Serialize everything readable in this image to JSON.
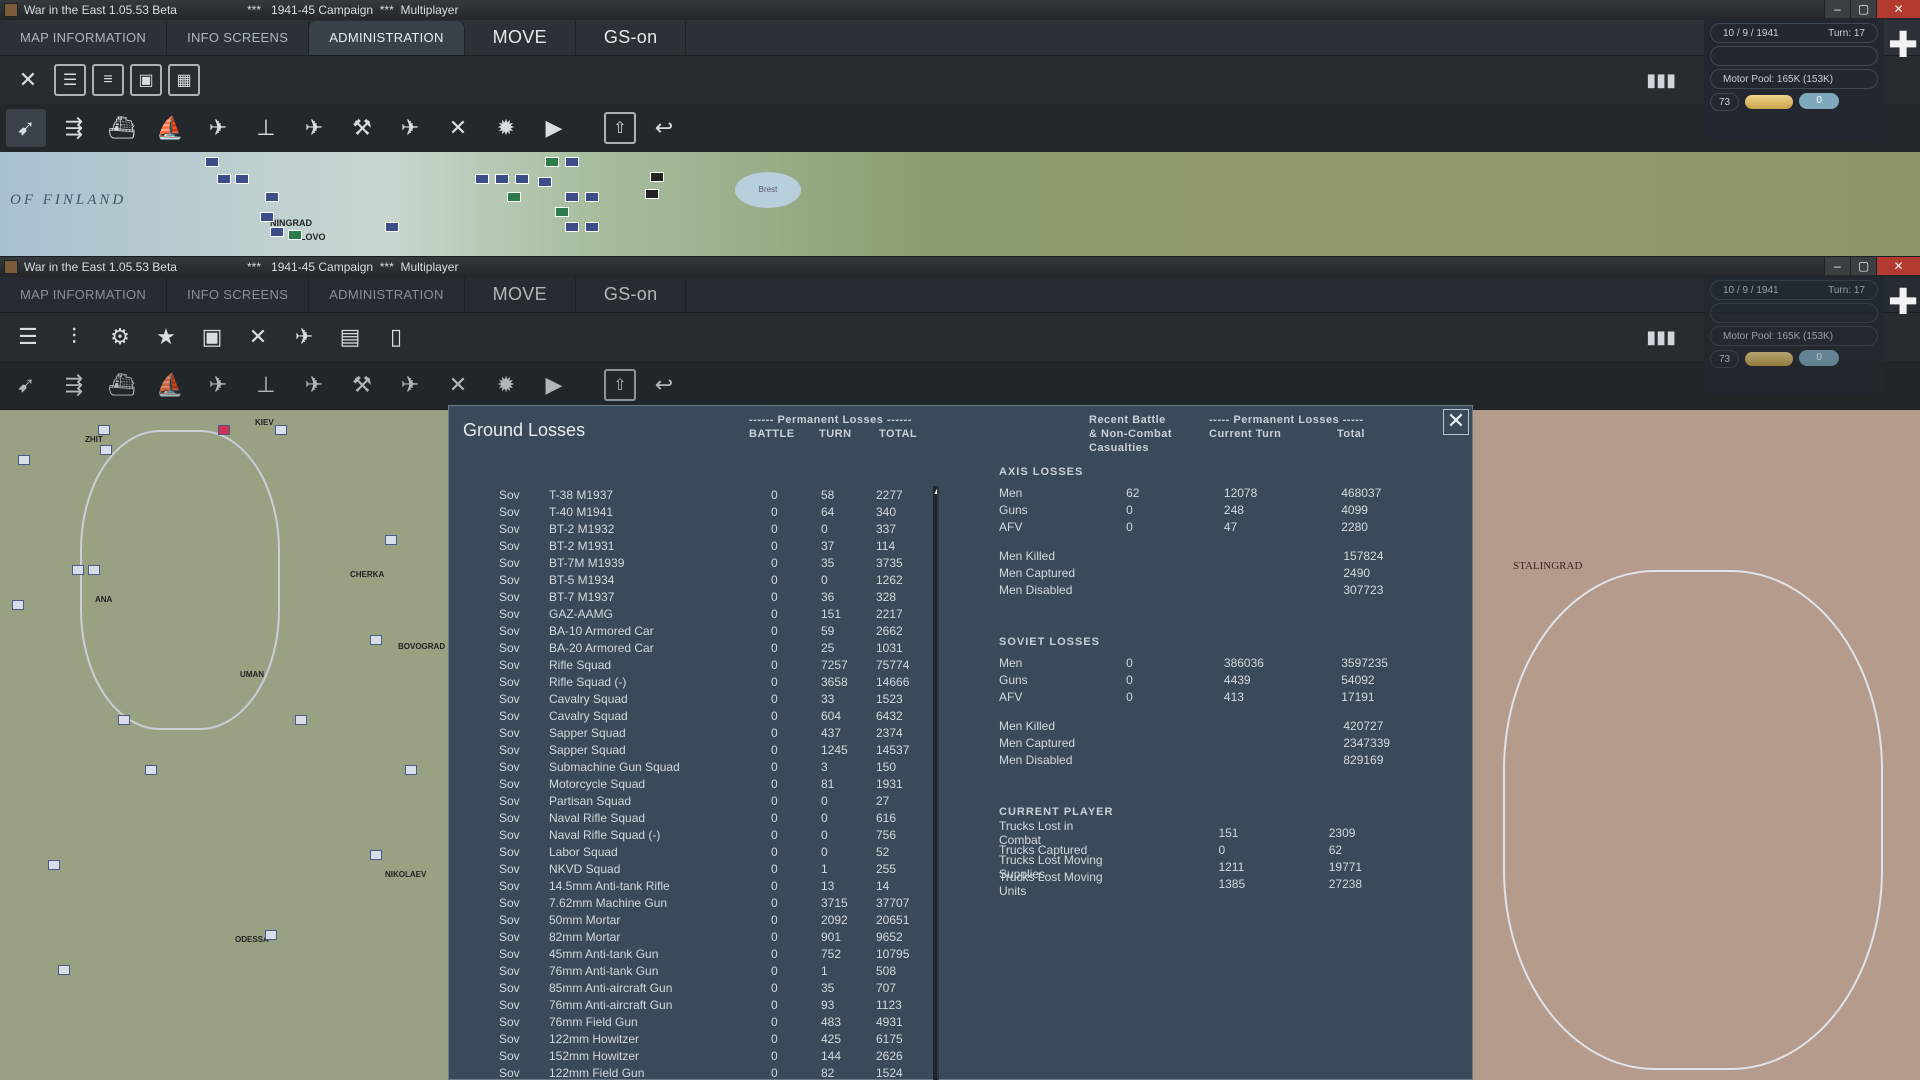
{
  "window": {
    "app_title": "War in the East 1.05.53 Beta",
    "campaign": "1941-45 Campaign",
    "mode": "Multiplayer",
    "stars": "***"
  },
  "menu": {
    "tabs": [
      "MAP INFORMATION",
      "INFO SCREENS",
      "ADMINISTRATION"
    ],
    "move": "MOVE",
    "gs": "GS-on"
  },
  "status": {
    "date": "10 / 9 / 1941",
    "turn": "Turn: 17",
    "motor_pool": "Motor Pool: 165K (153K)",
    "value": "73",
    "toggle": "0"
  },
  "toolbar_keys": [
    "F1",
    "F2",
    "F3",
    "F4",
    "F5",
    "F6",
    "F7",
    "F8",
    "F9",
    "F10",
    "F11",
    "F12"
  ],
  "map_top": {
    "sea_label": "OF FINLAND",
    "city1": "NINGRAD",
    "city2": "LOVO",
    "lake": "Brest"
  },
  "map_left": {
    "cities": [
      "KIEV",
      "ZHIT",
      "CHERKA",
      "UMAN",
      "ANA",
      "BOVOGRAD",
      "NIKOLAEV",
      "ODESSA"
    ]
  },
  "map_right": {
    "city": "STALINGRAD"
  },
  "dialog": {
    "title": "Ground Losses",
    "perm_header": "------ Permanent Losses ------",
    "col_battle": "BATTLE",
    "col_turn": "TURN",
    "col_total": "TOTAL",
    "recent_header": [
      "Recent Battle",
      "& Non-Combat",
      "Casualties"
    ],
    "perm_header2": "----- Permanent Losses -----",
    "col_current": "Current Turn",
    "col_total2": "Total",
    "close": "✕",
    "rows": [
      [
        "Sov",
        "T-38 M1937",
        "0",
        "58",
        "2277"
      ],
      [
        "Sov",
        "T-40 M1941",
        "0",
        "64",
        "340"
      ],
      [
        "Sov",
        "BT-2 M1932",
        "0",
        "0",
        "337"
      ],
      [
        "Sov",
        "BT-2 M1931",
        "0",
        "37",
        "114"
      ],
      [
        "Sov",
        "BT-7M M1939",
        "0",
        "35",
        "3735"
      ],
      [
        "Sov",
        "BT-5 M1934",
        "0",
        "0",
        "1262"
      ],
      [
        "Sov",
        "BT-7 M1937",
        "0",
        "36",
        "328"
      ],
      [
        "Sov",
        "GAZ-AAMG",
        "0",
        "151",
        "2217"
      ],
      [
        "Sov",
        "BA-10 Armored Car",
        "0",
        "59",
        "2662"
      ],
      [
        "Sov",
        "BA-20 Armored Car",
        "0",
        "25",
        "1031"
      ],
      [
        "Sov",
        "Rifle Squad",
        "0",
        "7257",
        "75774"
      ],
      [
        "Sov",
        "Rifle Squad (-)",
        "0",
        "3658",
        "14666"
      ],
      [
        "Sov",
        "Cavalry Squad",
        "0",
        "33",
        "1523"
      ],
      [
        "Sov",
        "Cavalry Squad",
        "0",
        "604",
        "6432"
      ],
      [
        "Sov",
        "Sapper Squad",
        "0",
        "437",
        "2374"
      ],
      [
        "Sov",
        "Sapper Squad",
        "0",
        "1245",
        "14537"
      ],
      [
        "Sov",
        "Submachine Gun Squad",
        "0",
        "3",
        "150"
      ],
      [
        "Sov",
        "Motorcycle Squad",
        "0",
        "81",
        "1931"
      ],
      [
        "Sov",
        "Partisan Squad",
        "0",
        "0",
        "27"
      ],
      [
        "Sov",
        "Naval Rifle Squad",
        "0",
        "0",
        "616"
      ],
      [
        "Sov",
        "Naval Rifle Squad (-)",
        "0",
        "0",
        "756"
      ],
      [
        "Sov",
        "Labor Squad",
        "0",
        "0",
        "52"
      ],
      [
        "Sov",
        "NKVD Squad",
        "0",
        "1",
        "255"
      ],
      [
        "Sov",
        "14.5mm Anti-tank Rifle",
        "0",
        "13",
        "14"
      ],
      [
        "Sov",
        "7.62mm Machine Gun",
        "0",
        "3715",
        "37707"
      ],
      [
        "Sov",
        "50mm Mortar",
        "0",
        "2092",
        "20651"
      ],
      [
        "Sov",
        "82mm Mortar",
        "0",
        "901",
        "9652"
      ],
      [
        "Sov",
        "45mm Anti-tank Gun",
        "0",
        "752",
        "10795"
      ],
      [
        "Sov",
        "76mm Anti-tank Gun",
        "0",
        "1",
        "508"
      ],
      [
        "Sov",
        "85mm Anti-aircraft Gun",
        "0",
        "35",
        "707"
      ],
      [
        "Sov",
        "76mm Anti-aircraft Gun",
        "0",
        "93",
        "1123"
      ],
      [
        "Sov",
        "76mm Field Gun",
        "0",
        "483",
        "4931"
      ],
      [
        "Sov",
        "122mm Howitzer",
        "0",
        "425",
        "6175"
      ],
      [
        "Sov",
        "152mm Howitzer",
        "0",
        "144",
        "2626"
      ],
      [
        "Sov",
        "122mm Field Gun",
        "0",
        "82",
        "1524"
      ]
    ],
    "axis": {
      "title": "AXIS LOSSES",
      "rows": [
        [
          "Men",
          "62",
          "12078",
          "468037"
        ],
        [
          "Guns",
          "0",
          "248",
          "4099"
        ],
        [
          "AFV",
          "0",
          "47",
          "2280"
        ]
      ],
      "extra": [
        [
          "Men Killed",
          "157824"
        ],
        [
          "Men Captured",
          "2490"
        ],
        [
          "Men Disabled",
          "307723"
        ]
      ]
    },
    "soviet": {
      "title": "SOVIET LOSSES",
      "rows": [
        [
          "Men",
          "0",
          "386036",
          "3597235"
        ],
        [
          "Guns",
          "0",
          "4439",
          "54092"
        ],
        [
          "AFV",
          "0",
          "413",
          "17191"
        ]
      ],
      "extra": [
        [
          "Men Killed",
          "420727"
        ],
        [
          "Men Captured",
          "2347339"
        ],
        [
          "Men Disabled",
          "829169"
        ]
      ]
    },
    "player": {
      "title": "CURRENT PLAYER",
      "rows": [
        [
          "Trucks Lost in Combat",
          "151",
          "2309"
        ],
        [
          "Trucks Captured",
          "0",
          "62"
        ],
        [
          "Trucks Lost Moving Supplies",
          "1211",
          "19771"
        ],
        [
          "Trucks Lost Moving Units",
          "1385",
          "27238"
        ]
      ]
    }
  }
}
